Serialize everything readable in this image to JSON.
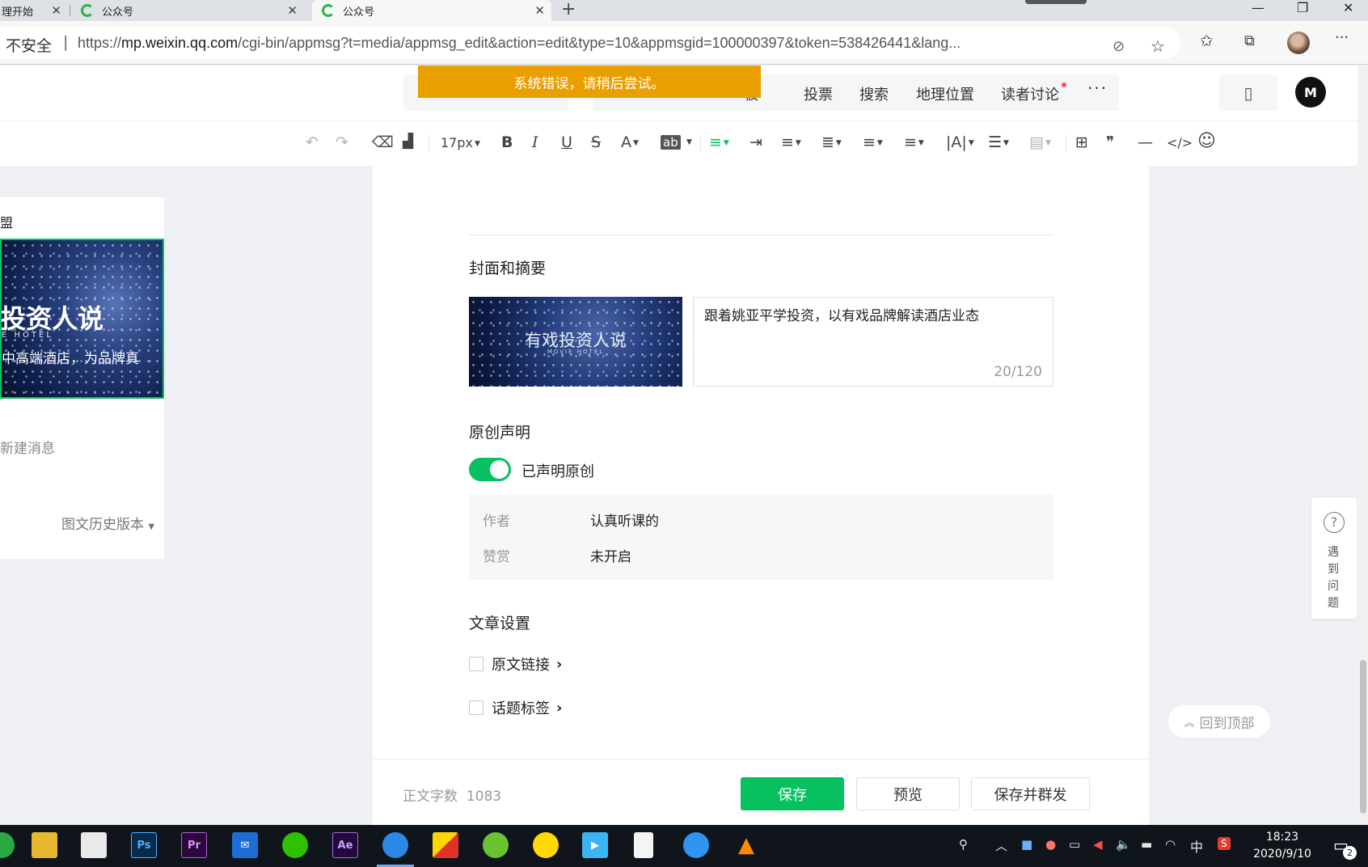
{
  "browser": {
    "tabs": [
      {
        "title": "理开始"
      },
      {
        "title": "公众号"
      },
      {
        "title": "公众号"
      }
    ],
    "newtab_symbol": "+",
    "window_controls": {
      "minimize": "—",
      "restore": "❐",
      "close": "✕"
    },
    "address": {
      "security_label": "不安全",
      "separator": "|",
      "scheme": "https://",
      "host": "mp.weixin.qq.com",
      "path": "/cgi-bin/appmsg?t=media/appmsg_edit&action=edit&type=10&appmsgid=100000397&token=538426441&lang..."
    },
    "toolbar_icons": {
      "block_icon": "⊘",
      "favorite": "☆",
      "favorites_list": "✩",
      "collections": "⧉",
      "more": "···"
    }
  },
  "insert_bar": {
    "error_message": "系统错误，请稍后尝试。",
    "items": [
      "板",
      "投票",
      "搜索",
      "地理位置",
      "读者讨论"
    ],
    "more": "···",
    "logo_text": "M"
  },
  "format_bar": {
    "font_size": "17px",
    "undo": "↶",
    "redo": "↷",
    "bold": "B",
    "italic": "I",
    "underline": "U",
    "strike": "S",
    "font_color": "A",
    "bg_color": "ab",
    "table": "⊞",
    "quote": "❞",
    "hr": "—",
    "code": "</>",
    "emoji": "☺"
  },
  "article_list": {
    "account_title": "盟",
    "thumb_title": "投资人说",
    "thumb_subtitle": "E HOTEL",
    "thumb_desc": "中高端酒店，为品牌真",
    "new_message": "新建消息",
    "history": "图文历史版本"
  },
  "editor": {
    "cover_section_title": "封面和摘要",
    "cover_title": "有戏投资人说",
    "cover_subtitle": "MOVIE HOTEL",
    "summary": "跟着姚亚平学投资，以有戏品牌解读酒店业态",
    "summary_count": "20/120",
    "original_section_title": "原创声明",
    "original_toggle_label": "已声明原创",
    "original_enabled": true,
    "meta": [
      {
        "key": "作者",
        "value": "认真听课的"
      },
      {
        "key": "赞赏",
        "value": "未开启"
      }
    ],
    "article_settings_title": "文章设置",
    "settings": [
      {
        "label": "原文链接",
        "checked": false
      },
      {
        "label": "话题标签",
        "checked": false
      }
    ]
  },
  "bottom_bar": {
    "word_count_label": "正文字数",
    "word_count": "1083",
    "save": "保存",
    "preview": "预览",
    "save_and_send": "保存并群发"
  },
  "help": {
    "icon": "?",
    "text": "遇到问题"
  },
  "back_to_top": "回到顶部",
  "taskbar": {
    "apps": [
      {
        "name": "file-explorer",
        "label": ""
      },
      {
        "name": "store",
        "label": ""
      },
      {
        "name": "photoshop",
        "label": "Ps"
      },
      {
        "name": "premiere",
        "label": "Pr"
      },
      {
        "name": "mail",
        "label": "✉"
      },
      {
        "name": "wechat",
        "label": ""
      },
      {
        "name": "after-effects",
        "label": "Ae"
      },
      {
        "name": "browser",
        "label": ""
      },
      {
        "name": "media",
        "label": ""
      },
      {
        "name": "app-green",
        "label": ""
      },
      {
        "name": "qq-music",
        "label": ""
      },
      {
        "name": "video-player",
        "label": "▶"
      },
      {
        "name": "notepad",
        "label": ""
      },
      {
        "name": "feishu",
        "label": ""
      },
      {
        "name": "vlc",
        "label": ""
      }
    ],
    "ime": "中",
    "time": "18:23",
    "date": "2020/9/10",
    "notification_count": "2"
  },
  "colors": {
    "accent": "#07c160",
    "toast": "#ea9f00",
    "taskbar": "#10151c"
  }
}
